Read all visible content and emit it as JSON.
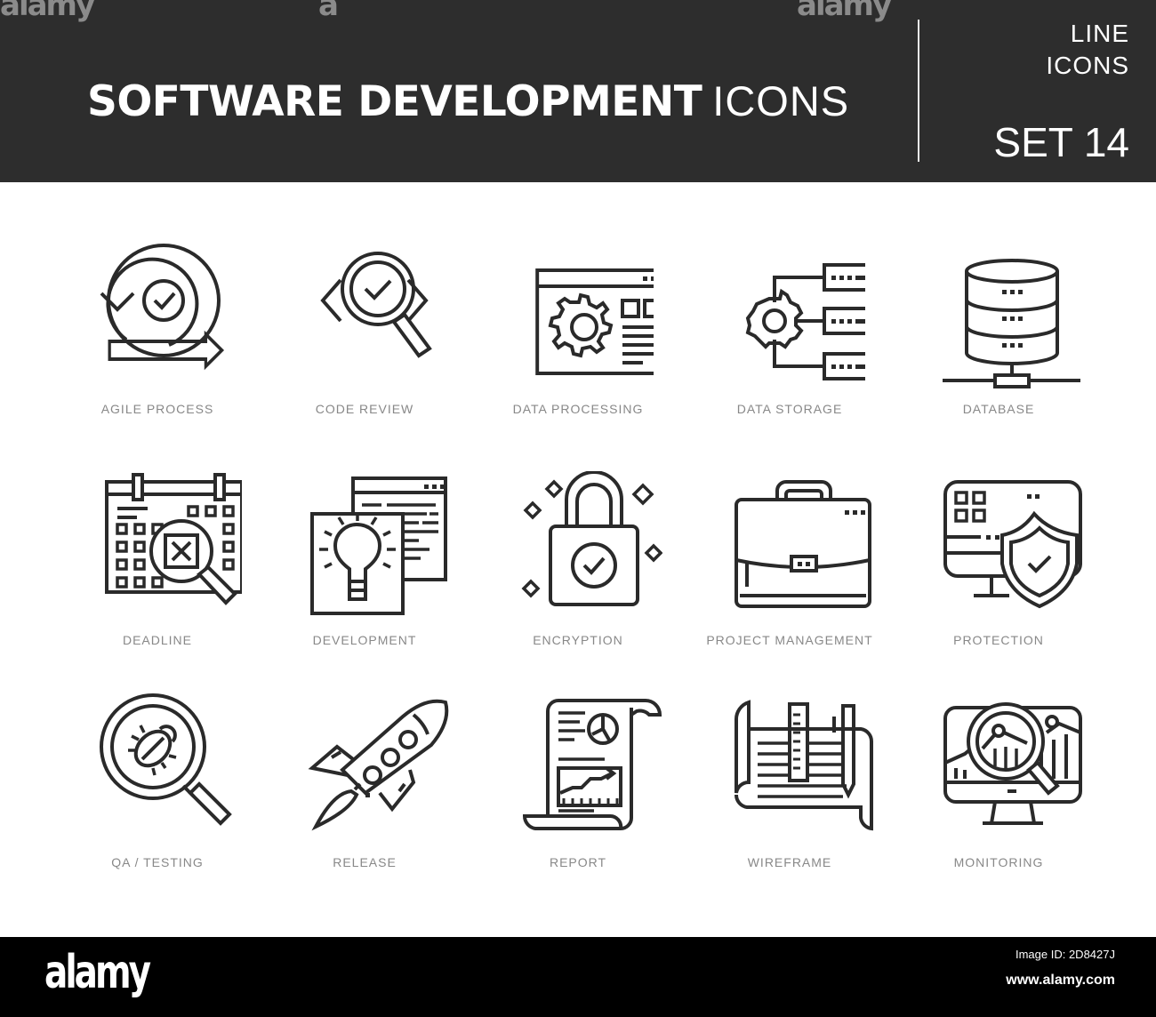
{
  "header": {
    "title_bold": "SOFTWARE DEVELOPMENT",
    "title_light": "ICONS",
    "tag_line1": "LINE",
    "tag_line2": "ICONS",
    "set_label": "SET 14",
    "background_color": "#2d2d2d"
  },
  "watermark": {
    "text": "alamy",
    "mark": "a"
  },
  "icons": [
    {
      "label": "AGILE PROCESS",
      "icon": "agile-process-icon"
    },
    {
      "label": "CODE REVIEW",
      "icon": "code-review-icon"
    },
    {
      "label": "DATA PROCESSING",
      "icon": "data-processing-icon"
    },
    {
      "label": "DATA STORAGE",
      "icon": "data-storage-icon"
    },
    {
      "label": "DATABASE",
      "icon": "database-icon"
    },
    {
      "label": "DEADLINE",
      "icon": "deadline-icon"
    },
    {
      "label": "DEVELOPMENT",
      "icon": "development-icon"
    },
    {
      "label": "ENCRYPTION",
      "icon": "encryption-icon"
    },
    {
      "label": "PROJECT MANAGEMENT",
      "icon": "project-management-icon"
    },
    {
      "label": "PROTECTION",
      "icon": "protection-icon"
    },
    {
      "label": "QA / TESTING",
      "icon": "qa-testing-icon"
    },
    {
      "label": "RELEASE",
      "icon": "release-icon"
    },
    {
      "label": "REPORT",
      "icon": "report-icon"
    },
    {
      "label": "WIREFRAME",
      "icon": "wireframe-icon"
    },
    {
      "label": "MONITORING",
      "icon": "monitoring-icon"
    }
  ],
  "colors": {
    "icon_stroke": "#2a2a2a",
    "label": "#888888",
    "header_text": "#ffffff"
  },
  "footer": {
    "logo": "alamy",
    "image_id": "Image ID: 2D8427J",
    "url": "www.alamy.com"
  }
}
